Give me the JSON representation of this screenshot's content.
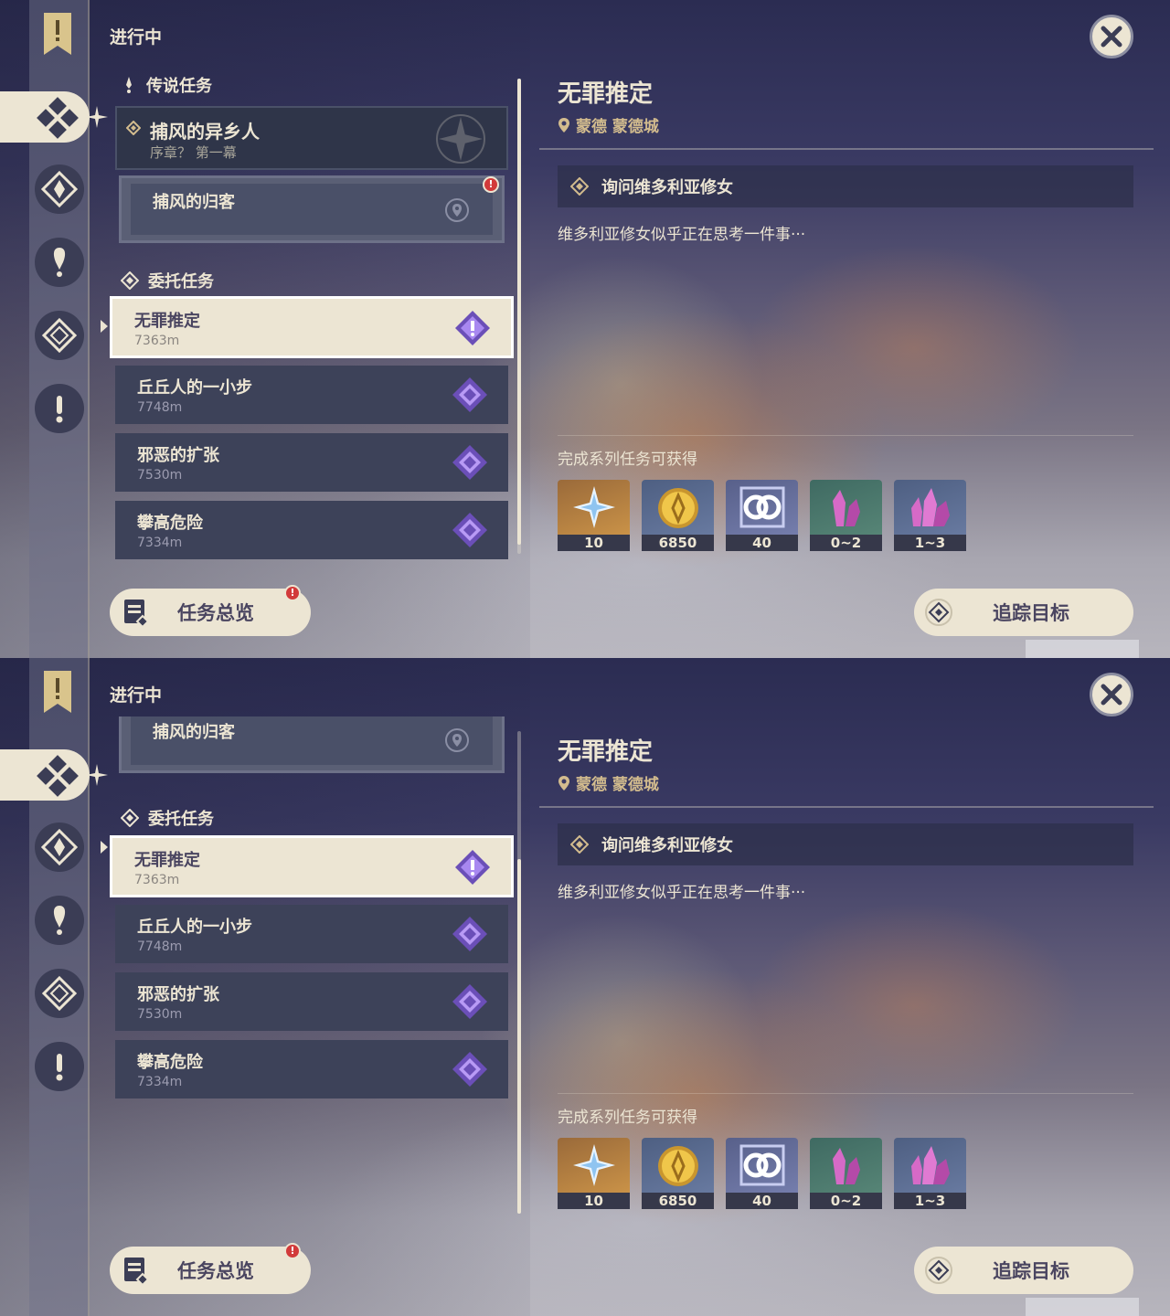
{
  "header": {
    "title": "进行中",
    "close_label": "close"
  },
  "sections": {
    "legend": "传说任务",
    "commission": "委托任务"
  },
  "legend_quest": {
    "name": "捕风的异乡人",
    "chapter": "序章？ 第一幕",
    "sub_quest": "捕风的归客"
  },
  "quests": [
    {
      "name": "无罪推定",
      "distance": "7363m"
    },
    {
      "name": "丘丘人的一小步",
      "distance": "7748m"
    },
    {
      "name": "邪恶的扩张",
      "distance": "7530m"
    },
    {
      "name": "攀高危险",
      "distance": "7334m"
    }
  ],
  "detail": {
    "title": "无罪推定",
    "location": "蒙德 蒙德城",
    "objective": "询问维多利亚修女",
    "description": "维多利亚修女似乎正在思考一件事···",
    "rewards_label": "完成系列任务可获得",
    "rewards": [
      {
        "icon": "primogem-icon",
        "count": "10"
      },
      {
        "icon": "mora-icon",
        "count": "6850"
      },
      {
        "icon": "companionship-exp-icon",
        "count": "40"
      },
      {
        "icon": "crystal-ore-icon",
        "count": "0~2"
      },
      {
        "icon": "crystal-chunk-icon",
        "count": "1~3"
      }
    ]
  },
  "buttons": {
    "overview": "任务总览",
    "track": "追踪目标",
    "badge": "!"
  },
  "colors": {
    "cream": "#ece5d3",
    "gold": "#d3bc8e",
    "quest_purple": "#8a6bd6",
    "alert_red": "#d23a3a"
  }
}
